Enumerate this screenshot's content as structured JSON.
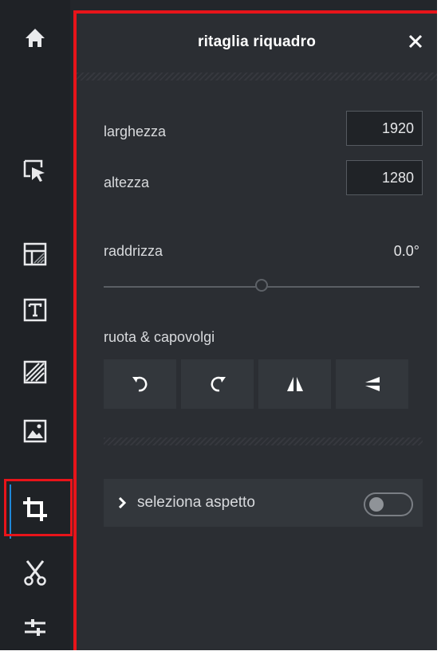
{
  "panel": {
    "title": "ritaglia riquadro",
    "width_label": "larghezza",
    "width_value": "1920",
    "height_label": "altezza",
    "height_value": "1280",
    "straighten_label": "raddrizza",
    "straighten_value": "0.0°",
    "straighten_level": 0.5,
    "rotate_flip_label": "ruota & capovolgi",
    "aspect_label": "seleziona aspetto",
    "aspect_toggle_on": false
  },
  "rail": {
    "tools": [
      {
        "icon": "home-icon"
      },
      {
        "icon": "select-pointer-icon"
      },
      {
        "icon": "layout-icon"
      },
      {
        "icon": "text-icon"
      },
      {
        "icon": "pattern-icon"
      },
      {
        "icon": "image-icon"
      },
      {
        "icon": "crop-icon",
        "active": true
      },
      {
        "icon": "scissors-icon"
      },
      {
        "icon": "sliders-icon"
      }
    ]
  },
  "rotate_buttons": [
    {
      "icon": "rotate-left-icon"
    },
    {
      "icon": "rotate-right-icon"
    },
    {
      "icon": "flip-horizontal-icon"
    },
    {
      "icon": "flip-vertical-icon"
    }
  ],
  "colors": {
    "accent_highlight": "#e8141a",
    "active_indicator": "#1f88d8",
    "panel_bg": "#2b2e33",
    "rail_bg": "#1f2226"
  }
}
